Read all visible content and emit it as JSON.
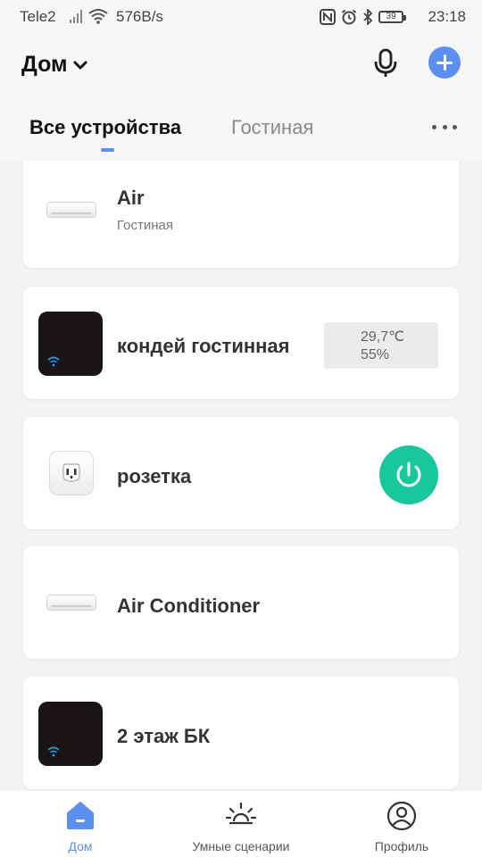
{
  "status_bar": {
    "carrier": "Tele2",
    "speed": "576B/s",
    "battery": "39",
    "time": "23:18"
  },
  "header": {
    "home_label": "Дом",
    "tabs": [
      {
        "label": "Все устройства",
        "active": true
      },
      {
        "label": "Гостиная",
        "active": false
      }
    ]
  },
  "devices": [
    {
      "name": "Air",
      "room": "Гостиная",
      "icon": "air-conditioner-image"
    },
    {
      "name": "кондей гостинная",
      "temperature": "29,7℃",
      "humidity": "55%",
      "icon": "ir-hub-image"
    },
    {
      "name": "розетка",
      "icon": "smart-socket-image",
      "power": "on"
    },
    {
      "name": "Air Conditioner",
      "icon": "air-conditioner-image"
    },
    {
      "name": "2 этаж БК",
      "icon": "ir-hub-image"
    }
  ],
  "bottom_nav": [
    {
      "label": "Дом",
      "icon": "home-icon",
      "active": true
    },
    {
      "label": "Умные сценарии",
      "icon": "sun-icon",
      "active": false
    },
    {
      "label": "Профиль",
      "icon": "profile-icon",
      "active": false
    }
  ],
  "colors": {
    "accent": "#5b8ff0",
    "power_on": "#18c89c",
    "background": "#f3f3f3"
  }
}
